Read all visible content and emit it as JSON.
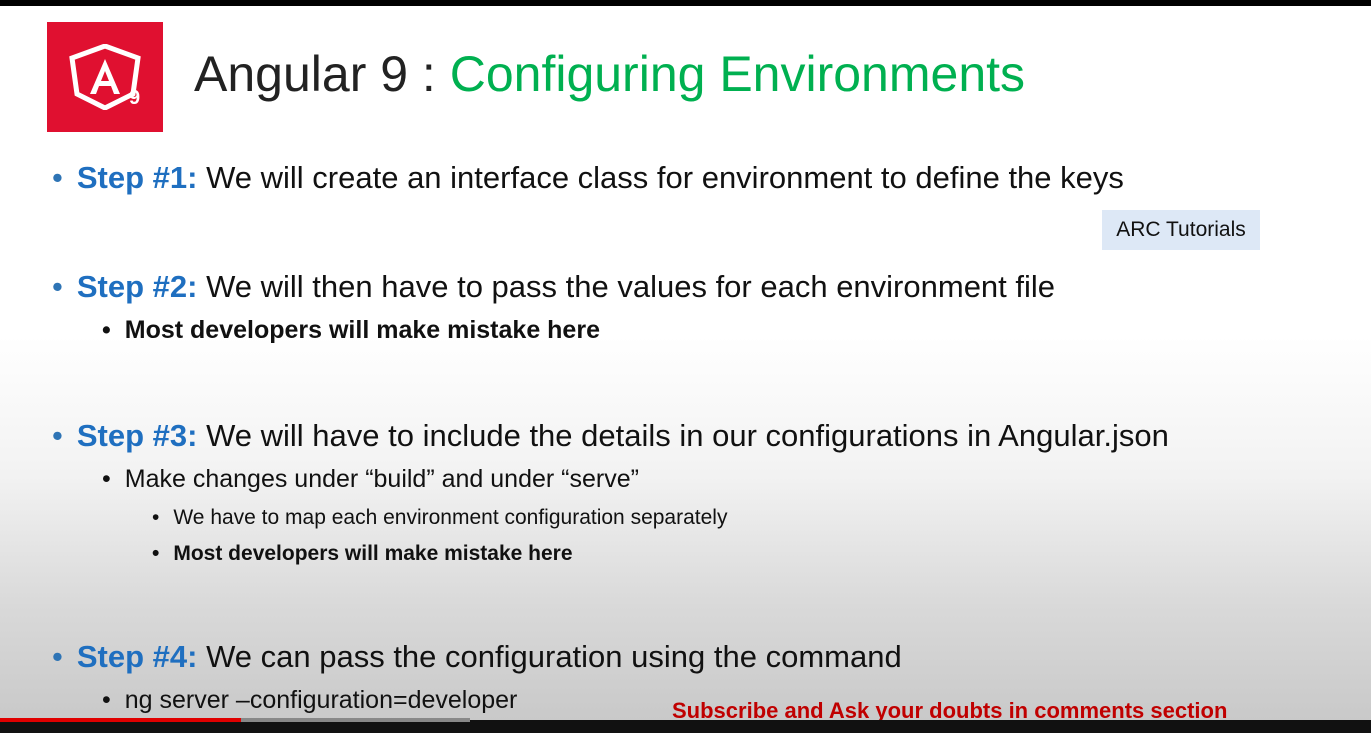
{
  "header": {
    "logo_text": "A9",
    "title_prefix": "Angular 9 : ",
    "title_highlight": "Configuring Environments",
    "logo_color": "#e01030",
    "highlight_color": "#00b050"
  },
  "watermark": "ARC Tutorials",
  "steps": [
    {
      "label": "Step #1:",
      "text": " We will create an interface class for environment to define the keys"
    },
    {
      "label": "Step #2:",
      "text": " We will then have to pass the values for each environment file",
      "sub": "Most developers will make mistake here"
    },
    {
      "label": "Step #3:",
      "text": " We will have to include the details in our configurations in Angular.json",
      "sub": "Make changes under “build” and under “serve”",
      "subsub": [
        "We have to map each environment configuration separately",
        "Most developers will make mistake here"
      ]
    },
    {
      "label": "Step #4:",
      "text": " We can pass the configuration using the command",
      "sub": "ng server –configuration=developer"
    }
  ],
  "bullet_char": "•",
  "banner": "Subscribe and Ask your doubts in comments section",
  "video": {
    "progress": 0.176
  }
}
